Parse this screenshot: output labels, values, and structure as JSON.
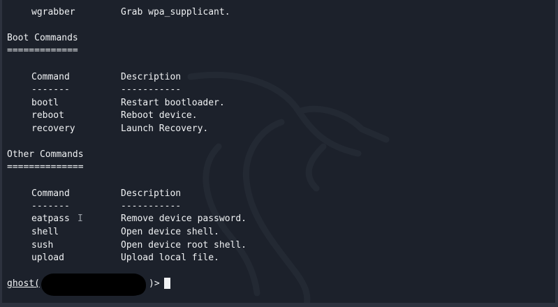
{
  "top": {
    "command": "wgrabber",
    "description": "Grab wpa_supplicant."
  },
  "boot": {
    "title": "Boot Commands",
    "underline": "=============",
    "col_command": "Command",
    "col_description": "Description",
    "dash_command": "-------",
    "dash_description": "-----------",
    "rows": [
      {
        "command": "bootl",
        "description": "Restart bootloader."
      },
      {
        "command": "reboot",
        "description": "Reboot device."
      },
      {
        "command": "recovery",
        "description": "Launch Recovery."
      }
    ]
  },
  "other": {
    "title": "Other Commands",
    "underline": "==============",
    "col_command": "Command",
    "col_description": "Description",
    "dash_command": "-------",
    "dash_description": "-----------",
    "rows": [
      {
        "command": "eatpass",
        "description": "Remove device password."
      },
      {
        "command": "shell",
        "description": "Open device shell."
      },
      {
        "command": "sush",
        "description": "Open device root shell."
      },
      {
        "command": "upload",
        "description": "Upload local file."
      }
    ]
  },
  "prompt": {
    "host": "ghost(",
    "suffix": ")>"
  },
  "colors": {
    "terminal_bg": "#1c212b",
    "text": "#f0f2f4",
    "frame": "#2d323e"
  }
}
